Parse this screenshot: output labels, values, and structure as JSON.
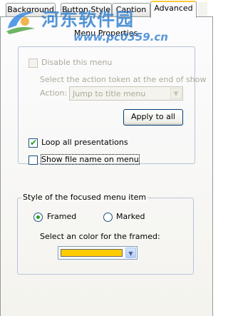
{
  "tabs": [
    {
      "label": "Background",
      "active": false
    },
    {
      "label": "Button Style",
      "active": false
    },
    {
      "label": "Caption",
      "active": false
    },
    {
      "label": "Advanced",
      "active": true
    }
  ],
  "menu_properties": {
    "title": "Menu Properties",
    "disable_menu": {
      "label": "Disable this menu",
      "checked": false,
      "enabled": false
    },
    "action_hint": "Select the action token at the end of show",
    "action_label": "Action:",
    "action_value": "Jump to title menu",
    "apply_to_all": "Apply to all",
    "loop_all": {
      "label": "Loop all presentations",
      "checked": true
    },
    "show_file_name": {
      "label": "Show file name on menu",
      "checked": false
    }
  },
  "focused_style": {
    "title": "Style of the focused menu item",
    "framed": {
      "label": "Framed",
      "selected": true
    },
    "marked": {
      "label": "Marked",
      "selected": false
    },
    "color_prompt": "Select an color for the framed:",
    "frame_color": "#ffcc00"
  },
  "watermark": {
    "text": "河东软件园",
    "url": "www.pc0359.cn"
  },
  "colors": {
    "tab_highlight": "#ffc83c",
    "check_green": "#21a121",
    "panel_border": "#919b9c",
    "group_border": "#b7c4d6"
  }
}
